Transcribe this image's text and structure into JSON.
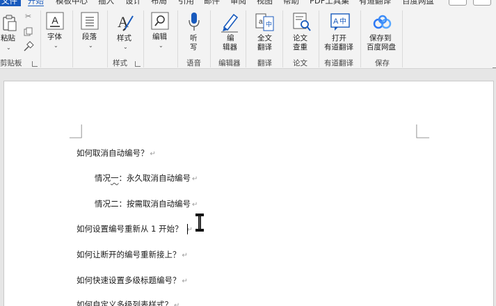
{
  "tabs": {
    "file": "文件",
    "items": [
      "开始",
      "模板中心",
      "插入",
      "设计",
      "布局",
      "引用",
      "邮件",
      "审阅",
      "视图",
      "帮助",
      "PDF工具集",
      "有道翻译",
      "百度网盘"
    ]
  },
  "ribbon": {
    "clipboard": {
      "paste": "粘贴",
      "group": "剪贴板"
    },
    "font": {
      "label": "字体"
    },
    "paragraph": {
      "label": "段落"
    },
    "styles": {
      "label": "样式",
      "group": "样式"
    },
    "editing": {
      "label": "编辑"
    },
    "voice": {
      "label_top": "听",
      "label_bottom": "写",
      "group": "语音"
    },
    "editor": {
      "label_top": "编",
      "label_bottom": "辑器",
      "group": "编辑器"
    },
    "translate": {
      "label_top": "全文",
      "label_bottom": "翻译",
      "group": "翻译"
    },
    "paper": {
      "label_top": "论文",
      "label_bottom": "查重",
      "group": "论文"
    },
    "youdao": {
      "label_top": "打开",
      "label_bottom": "有道翻译",
      "group": "有道翻译"
    },
    "baidu": {
      "label_top": "保存到",
      "label_bottom": "百度网盘",
      "group": "保存"
    }
  },
  "document": {
    "paragraphs": [
      {
        "text": "如何取消自动编号？"
      },
      {
        "prefix": "情况",
        "squig": "一",
        "text": "：永久取消自动编号"
      },
      {
        "text": "情况二：按需取消自动编号"
      },
      {
        "text": "如何设置编号重新从 1 开始？"
      },
      {
        "text": "如何让断开的编号重新接上？"
      },
      {
        "text": "如何快速设置多级标题编号？"
      },
      {
        "text": "如何自定义多级列表样式？"
      }
    ],
    "paragraph_mark": "↵"
  }
}
